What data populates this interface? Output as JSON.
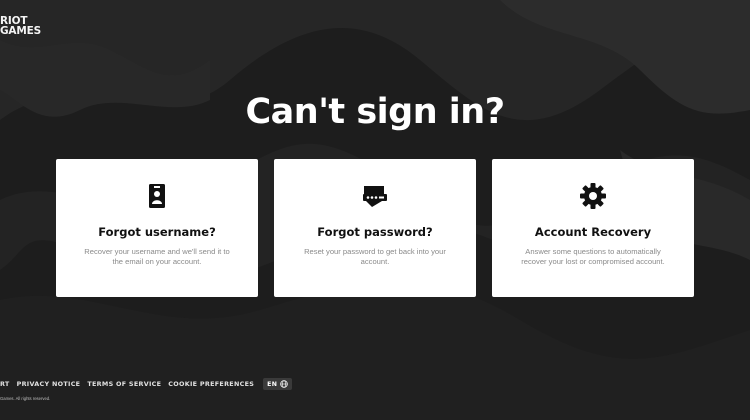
{
  "brand": {
    "logo_line1": "RIOT",
    "logo_line2": "GAMES"
  },
  "page": {
    "title": "Can't sign in?"
  },
  "cards": [
    {
      "icon": "id-badge-icon",
      "title": "Forgot username?",
      "description": "Recover your username and we'll send it to the email on your account."
    },
    {
      "icon": "password-key-icon",
      "title": "Forgot password?",
      "description": "Reset your password to get back into your account."
    },
    {
      "icon": "gear-icon",
      "title": "Account Recovery",
      "description": "Answer some questions to automatically recover your lost or compromised account."
    }
  ],
  "footer": {
    "links": [
      "RT",
      "PRIVACY NOTICE",
      "TERMS OF SERVICE",
      "COOKIE PREFERENCES"
    ],
    "language": "EN",
    "copyright": "Games. All rights reserved."
  },
  "colors": {
    "background": "#1c1c1c",
    "card": "#ffffff",
    "title": "#111111"
  }
}
